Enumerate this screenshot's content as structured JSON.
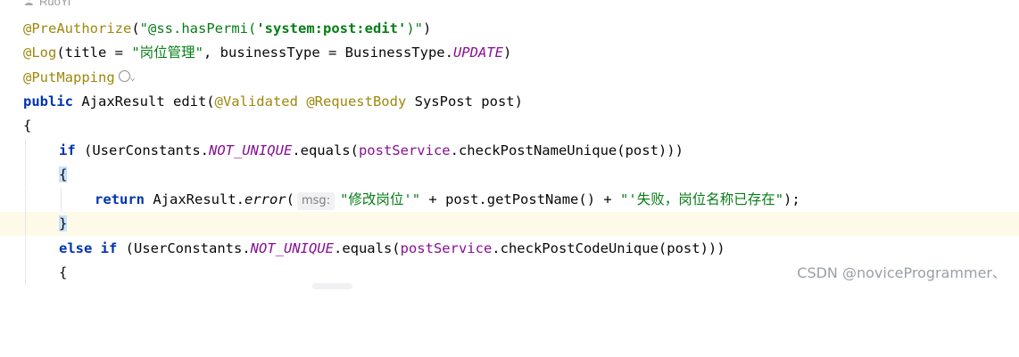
{
  "author": {
    "icon": "user-icon",
    "name": "RuoYi"
  },
  "code": {
    "preauth_ann": "@PreAuthorize",
    "preauth_open": "(",
    "preauth_str_a": "\"@ss.hasPermi(",
    "preauth_str_b": "'system:post:edit'",
    "preauth_str_c": ")\"",
    "preauth_close": ")",
    "log_ann": "@Log",
    "log_open": "(title = ",
    "log_str": "\"岗位管理\"",
    "log_mid": ", businessType = BusinessType.",
    "log_const": "UPDATE",
    "log_close": ")",
    "putmapping_ann": "@PutMapping",
    "web_icon": "globe-icon",
    "chevron": "⌄",
    "sig_kw": "public",
    "sig_mid": " AjaxResult edit(",
    "sig_ann1": "@Validated",
    "sig_ann2": "@RequestBody",
    "sig_end": " SysPost post)",
    "open_brace": "{",
    "if1_kw": "if",
    "if1_a": " (UserConstants.",
    "if1_const": "NOT_UNIQUE",
    "if1_b": ".equals(",
    "if1_field": "postService",
    "if1_c": ".checkPostNameUnique(post)))",
    "inner_open": "{",
    "ret_kw": "return",
    "ret_a": " AjaxResult.",
    "ret_method": "error",
    "ret_paren": "(",
    "ret_hint": "msg:",
    "ret_str1": "\"修改岗位'\"",
    "ret_mid": " + post.getPostName() + ",
    "ret_str2": "\"'失败，岗位名称已存在\"",
    "ret_end": ");",
    "inner_close": "}",
    "elseif_kw1": "else",
    "elseif_kw2": "if",
    "elseif_a": " (UserConstants.",
    "elseif_const": "NOT_UNIQUE",
    "elseif_b": ".equals(",
    "elseif_field": "postService",
    "elseif_c": ".checkPostCodeUnique(post)))",
    "last_open": "{"
  },
  "watermark": "CSDN @noviceProgrammer、",
  "colors": {
    "annotation": "#9e880d",
    "keyword": "#0033b3",
    "string": "#067d17",
    "constant": "#871094",
    "brace_match": "#c8e1ff",
    "current_line": "#fdfbe8"
  }
}
